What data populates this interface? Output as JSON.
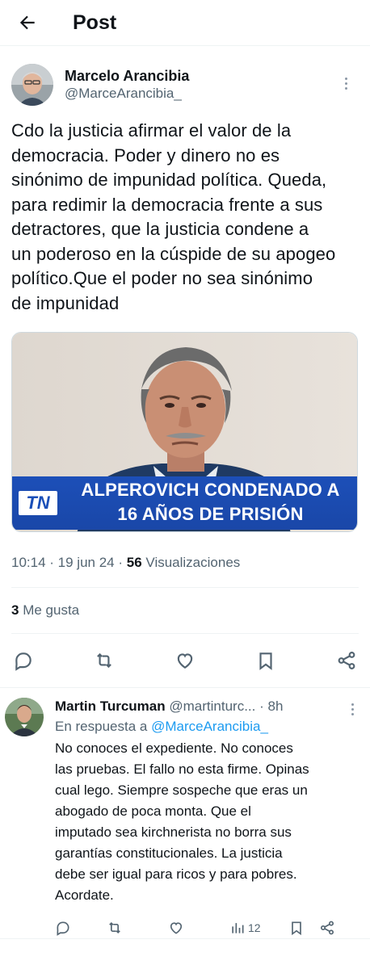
{
  "header": {
    "title": "Post",
    "back_icon": "arrow-left-icon"
  },
  "post": {
    "author_name": "Marcelo Arancibia",
    "author_handle": "@MarceArancibia_",
    "text": "Cdo la justicia afirmar el valor de la\ndemocracia. Poder y dinero no es\nsinónimo de impunidad política. Queda,\npara redimir la democracia frente a sus\ndetractores, que la justicia condene a\nun poderoso en la cúspide de su apogeo\npolítico.Que el poder no sea sinónimo\nde impunidad",
    "media": {
      "logo_text": "TN",
      "headline_line1": "ALPEROVICH CONDENADO A",
      "headline_line2": "16 AÑOS DE PRISIÓN"
    },
    "time": "10:14",
    "date": "19 jun 24",
    "views_count": "56",
    "views_label": "Visualizaciones",
    "likes_count": "3",
    "likes_label": "Me gusta"
  },
  "reply": {
    "name": "Martin Turcuman",
    "handle": "@martinturc...",
    "time": "8h",
    "in_reply_prefix": "En respuesta a",
    "in_reply_handle": "@MarceArancibia_",
    "text": "No conoces el expediente. No conoces\nlas pruebas. El fallo no esta firme. Opinas\ncual lego. Siempre sospeche que eras un\nabogado de poca monta. Que el\nimputado sea kirchnerista no borra sus\ngarantías constitucionales. La justicia\ndebe ser igual para ricos y para pobres.\nAcordate.",
    "views": "12"
  },
  "colors": {
    "accent": "#1d9bf0",
    "secondary_text": "#536471",
    "tn_blue": "#1c4fb8"
  }
}
